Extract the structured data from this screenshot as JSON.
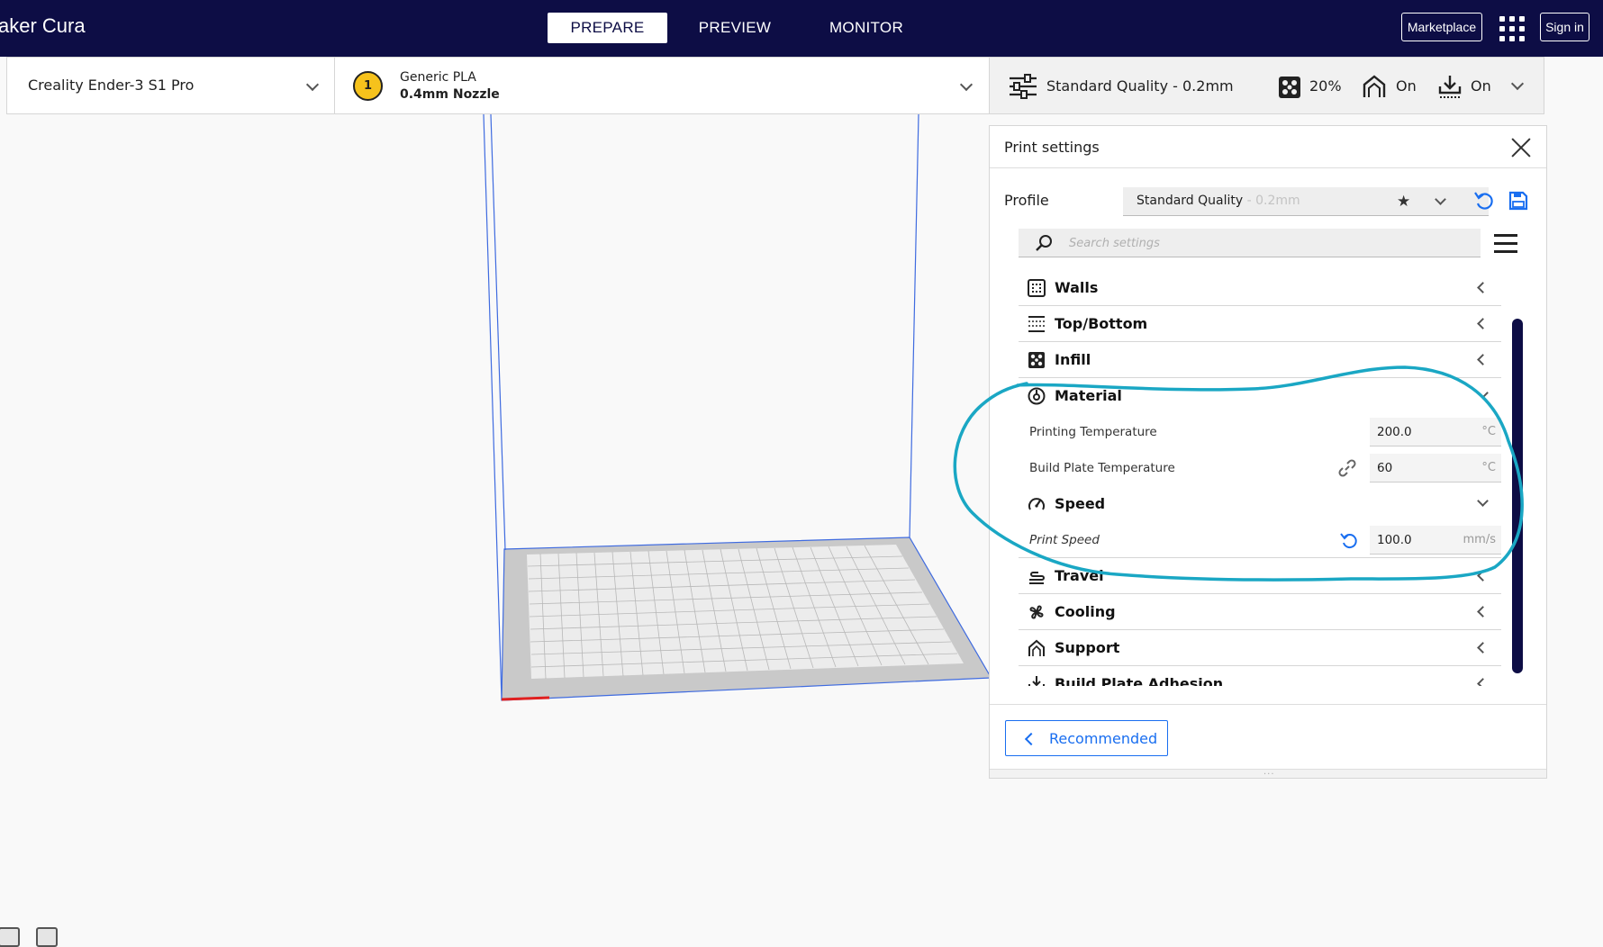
{
  "app": {
    "title": "aker Cura"
  },
  "stages": [
    {
      "label": "PREPARE",
      "active": true
    },
    {
      "label": "PREVIEW",
      "active": false
    },
    {
      "label": "MONITOR",
      "active": false
    }
  ],
  "header": {
    "marketplace_label": "Marketplace",
    "signin_label": "Sign in"
  },
  "printer": {
    "name": "Creality Ender-3 S1 Pro"
  },
  "material": {
    "extruder_number": "1",
    "name": "Generic PLA",
    "nozzle": "0.4mm Nozzle",
    "extruder_color": "#f6c21c"
  },
  "quality_bar": {
    "profile": "Standard Quality - 0.2mm",
    "infill": "20%",
    "support": "On",
    "adhesion": "On"
  },
  "print_settings": {
    "title": "Print settings",
    "profile_label": "Profile",
    "profile_name": "Standard Quality",
    "profile_layer": " - 0.2mm",
    "search_placeholder": "Search settings",
    "categories": [
      {
        "label": "Walls",
        "icon": "walls-icon",
        "expanded": false
      },
      {
        "label": "Top/Bottom",
        "icon": "top-bottom-icon",
        "expanded": false
      },
      {
        "label": "Infill",
        "icon": "infill-icon",
        "expanded": false
      },
      {
        "label": "Material",
        "icon": "material-icon",
        "expanded": true
      },
      {
        "label": "Speed",
        "icon": "speed-icon",
        "expanded": true
      },
      {
        "label": "Travel",
        "icon": "travel-icon",
        "expanded": false
      },
      {
        "label": "Cooling",
        "icon": "cooling-icon",
        "expanded": false
      },
      {
        "label": "Support",
        "icon": "support-icon",
        "expanded": false
      },
      {
        "label": "Build Plate Adhesion",
        "icon": "adhesion-icon",
        "expanded": false
      }
    ],
    "settings": [
      {
        "label": "Printing Temperature",
        "value": "200.0",
        "unit": "°C"
      },
      {
        "label": "Build Plate Temperature",
        "value": "60",
        "unit": "°C"
      },
      {
        "label": "Print Speed",
        "value": "100.0",
        "unit": "mm/s"
      }
    ],
    "recommended_label": "Recommended"
  },
  "colors": {
    "header_bg": "#0d0d45",
    "accent_blue": "#196ef0",
    "annotation": "#1aa7c4",
    "build_volume_line": "#3f6be0"
  }
}
